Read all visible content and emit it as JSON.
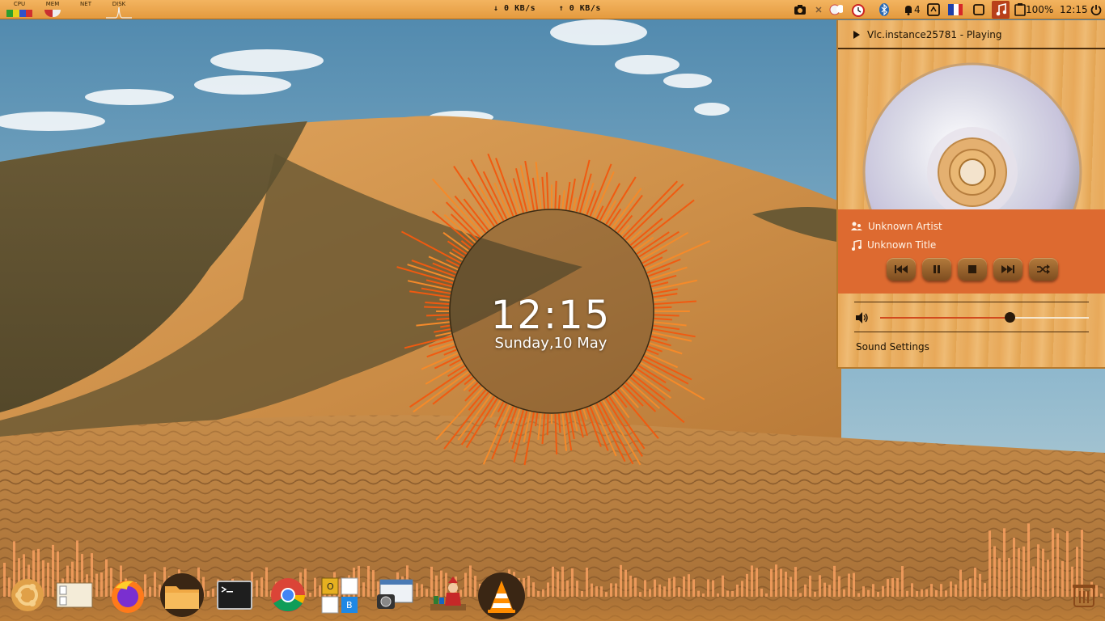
{
  "top_panel": {
    "monitors": {
      "cpu": "CPU",
      "mem": "MEM",
      "net": "NET",
      "disk": "DISK"
    },
    "net_down": "↓ 0 KB/s",
    "net_up": "↑ 0 KB/s",
    "notifications_count": "4",
    "battery": "100%",
    "time": "12:15",
    "icons": [
      "screenshot-icon",
      "close-icon",
      "weather-icon",
      "alarm-clock-icon",
      "bluetooth-icon",
      "notification-bell-icon",
      "screen-lock-icon",
      "french-flag-icon",
      "window-icon",
      "music-note-icon",
      "clipboard-icon",
      "power-icon"
    ]
  },
  "sound_menu": {
    "player_name": "Vlc.instance25781 - Playing",
    "artist": "Unknown Artist",
    "title": "Unknown Title",
    "controls": [
      "previous-icon",
      "pause-icon",
      "stop-icon",
      "next-icon",
      "shuffle-icon"
    ],
    "volume_level": 0.62,
    "settings_label": "Sound Settings"
  },
  "clock_widget": {
    "time": "12:15",
    "date": "Sunday,10 May"
  },
  "dock": {
    "items": [
      "ubuntu-logo-icon",
      "document-viewer-icon",
      "firefox-icon",
      "files-icon",
      "terminal-icon",
      "chrome-icon",
      "office-icon",
      "screenshot-tool-icon",
      "game-icon",
      "vlc-icon",
      "trash-icon"
    ]
  },
  "colors": {
    "panel": "#e9a548",
    "accent": "#dd6a30",
    "visualizer": "#f05a10",
    "visualizer_dock": "#f8a060"
  }
}
